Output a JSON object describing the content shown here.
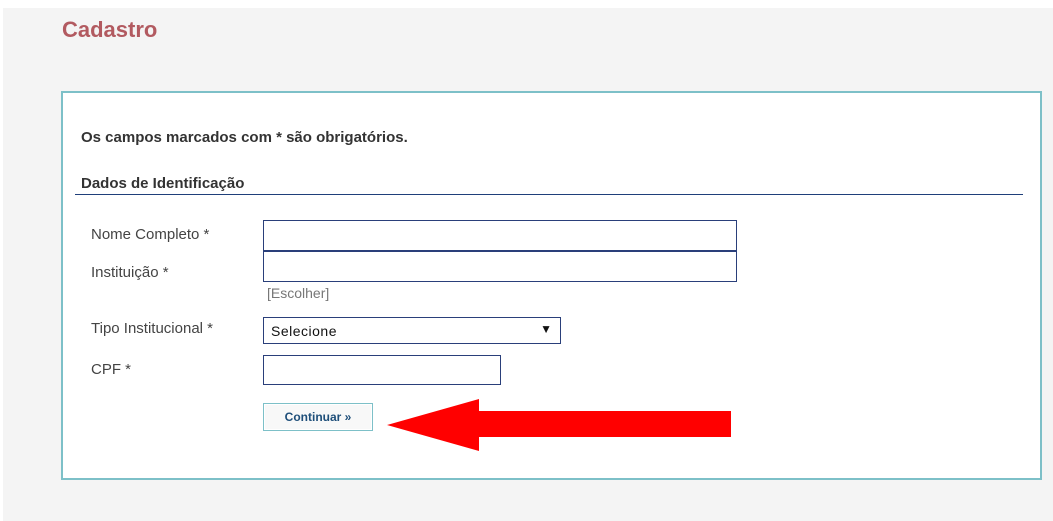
{
  "page": {
    "title": "Cadastro"
  },
  "form": {
    "notice": "Os campos marcados com * são obrigatórios.",
    "section_title": "Dados de Identificação",
    "fields": {
      "nome": {
        "label": "Nome Completo *",
        "value": ""
      },
      "instituicao": {
        "label": "Instituição *",
        "value": "",
        "choose_link": "[Escolher]"
      },
      "tipo": {
        "label": "Tipo Institucional *",
        "selected": "Selecione"
      },
      "cpf": {
        "label": "CPF *",
        "value": ""
      }
    },
    "submit_label": "Continuar »"
  },
  "annotation": {
    "arrow_color": "#ff0000"
  },
  "colors": {
    "title": "#b25a60",
    "panel_border": "#7dc0c8",
    "input_border": "#2a3f7a"
  }
}
